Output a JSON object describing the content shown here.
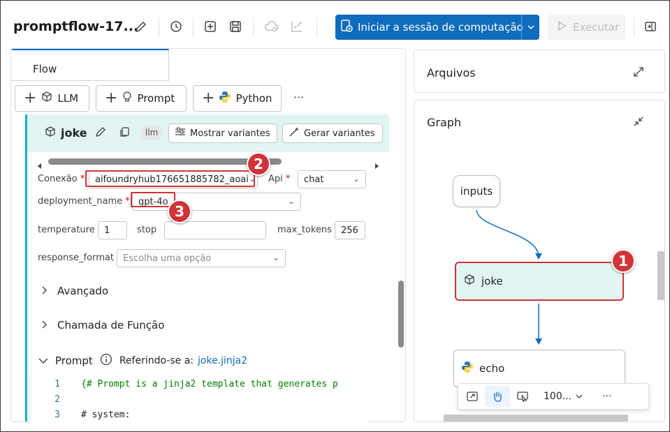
{
  "toolbar": {
    "title": "promptflow-17...",
    "start_session_label": "Iniciar a sessão de computação",
    "execute_label": "Executar"
  },
  "left": {
    "tab_label": "Flow",
    "add_llm": "LLM",
    "add_prompt": "Prompt",
    "add_python": "Python",
    "more": "···"
  },
  "node": {
    "name": "joke",
    "type_badge": "llm",
    "show_variants": "Mostrar variantes",
    "generate_variants": "Gerar variantes",
    "connection_label": "Conexão",
    "connection_value": "aifoundryhub176651885782_aoai",
    "api_label": "Api",
    "api_value": "chat",
    "deployment_label": "deployment_name",
    "deployment_value": "gpt-4o",
    "temperature_label": "temperature",
    "temperature_value": "1",
    "stop_label": "stop",
    "stop_value": "",
    "max_tokens_label": "max_tokens",
    "max_tokens_value": "256",
    "response_format_label": "response_format",
    "response_format_placeholder": "Escolha uma opção",
    "required_mark": "*",
    "advanced": "Avançado",
    "function_call": "Chamada de Função",
    "prompt_label": "Prompt",
    "referring_label": "Referindo-se a:",
    "prompt_file": "joke.jinja2",
    "code_lines": [
      {
        "n": "1",
        "text": "{# Prompt is a jinja2 template that generates p",
        "color": "#008000"
      },
      {
        "n": "2",
        "text": "",
        "color": "#242424"
      },
      {
        "n": "3",
        "text": "# system:",
        "color": "#242424"
      }
    ]
  },
  "files_panel": {
    "title": "Arquivos"
  },
  "graph_panel": {
    "title": "Graph",
    "nodes": {
      "inputs": "inputs",
      "joke": "joke",
      "echo": "echo"
    },
    "zoom": "100..."
  },
  "callouts": [
    "1",
    "2",
    "3"
  ],
  "colors": {
    "accent": "#0f6cbd",
    "callout": "#d13438",
    "node_highlight": "#e1f5f3",
    "edge": "#0f6cbd"
  }
}
